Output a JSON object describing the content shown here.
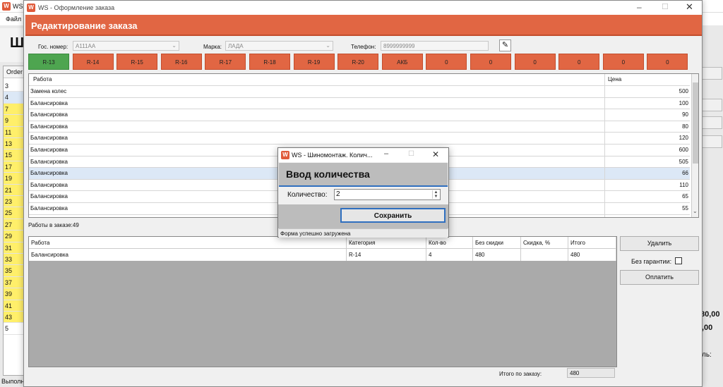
{
  "background_app": {
    "title": "WS -",
    "menu_file": "Файл",
    "header_fragment": "Ш",
    "orders_header": "Order",
    "order_rows": [
      {
        "text": "3",
        "color": "white"
      },
      {
        "text": "4",
        "color": "blue"
      },
      {
        "text": "7",
        "color": "yellow"
      },
      {
        "text": "9",
        "color": "yellow"
      },
      {
        "text": "11",
        "color": "yellow"
      },
      {
        "text": "13",
        "color": "yellow"
      },
      {
        "text": "15",
        "color": "yellow"
      },
      {
        "text": "17",
        "color": "yellow"
      },
      {
        "text": "19",
        "color": "yellow"
      },
      {
        "text": "21",
        "color": "yellow"
      },
      {
        "text": "23",
        "color": "yellow"
      },
      {
        "text": "25",
        "color": "yellow"
      },
      {
        "text": "27",
        "color": "yellow"
      },
      {
        "text": "29",
        "color": "yellow"
      },
      {
        "text": "31",
        "color": "yellow"
      },
      {
        "text": "33",
        "color": "yellow"
      },
      {
        "text": "35",
        "color": "yellow"
      },
      {
        "text": "37",
        "color": "yellow"
      },
      {
        "text": "39",
        "color": "yellow"
      },
      {
        "text": "41",
        "color": "yellow"
      },
      {
        "text": "43",
        "color": "yellow"
      },
      {
        "text": "5",
        "color": "white"
      }
    ],
    "status_fragment": "Выполн",
    "right_value_1": "80,00",
    "right_value_2": ",00",
    "right_label_fragment": "ль:"
  },
  "window": {
    "title": "WS - Оформление заказа",
    "header": "Редактирование заказа",
    "plate_label": "Гос. номер:",
    "plate_value": "А111АА",
    "brand_label": "Марка:",
    "brand_value": "ЛАДА",
    "phone_label": "Телефон:",
    "phone_value": "8999999999",
    "tabs": [
      "R-13",
      "R-14",
      "R-15",
      "R-16",
      "R-17",
      "R-18",
      "R-19",
      "R-20",
      "АКБ",
      "0",
      "0",
      "0",
      "0",
      "0",
      "0"
    ],
    "works_headers": {
      "work": "Работа",
      "price": "Цена"
    },
    "works": [
      {
        "name": "Замена колес",
        "price": "500"
      },
      {
        "name": "Балансировка",
        "price": "100"
      },
      {
        "name": "Балансировка",
        "price": "90"
      },
      {
        "name": "Балансировка",
        "price": "80"
      },
      {
        "name": "Балансировка",
        "price": "120"
      },
      {
        "name": "Балансировка",
        "price": "600"
      },
      {
        "name": "Балансировка",
        "price": "505"
      },
      {
        "name": "Балансировка",
        "price": "66"
      },
      {
        "name": "Балансировка",
        "price": "110"
      },
      {
        "name": "Балансировка",
        "price": "65"
      },
      {
        "name": "Балансировка",
        "price": "55"
      }
    ],
    "works_count": "Работы в заказе:49",
    "items_headers": [
      "Работа",
      "Категория",
      "Кол-во",
      "Без скидки",
      "Скидка, %",
      "Итого"
    ],
    "items": [
      [
        "Балансировка",
        "R-14",
        "4",
        "480",
        "",
        "480"
      ]
    ],
    "delete_button": "Удалить",
    "no_warranty_label": "Без гарантии:",
    "pay_button": "Оплатить",
    "total_label": "Итого по заказу:",
    "total_value": "480"
  },
  "dialog": {
    "title": "WS - Шиномонтаж. Колич...",
    "header": "Ввод количества",
    "quantity_label": "Количество:",
    "quantity_value": "2",
    "save_button": "Сохранить",
    "status": "Форма успешно загружена"
  },
  "colors": {
    "header_orange": "#e16643",
    "tab_active_green": "#4ea550",
    "row_highlight_yellow": "#ffef6a",
    "dialog_focus_blue": "#2f6fbf"
  }
}
